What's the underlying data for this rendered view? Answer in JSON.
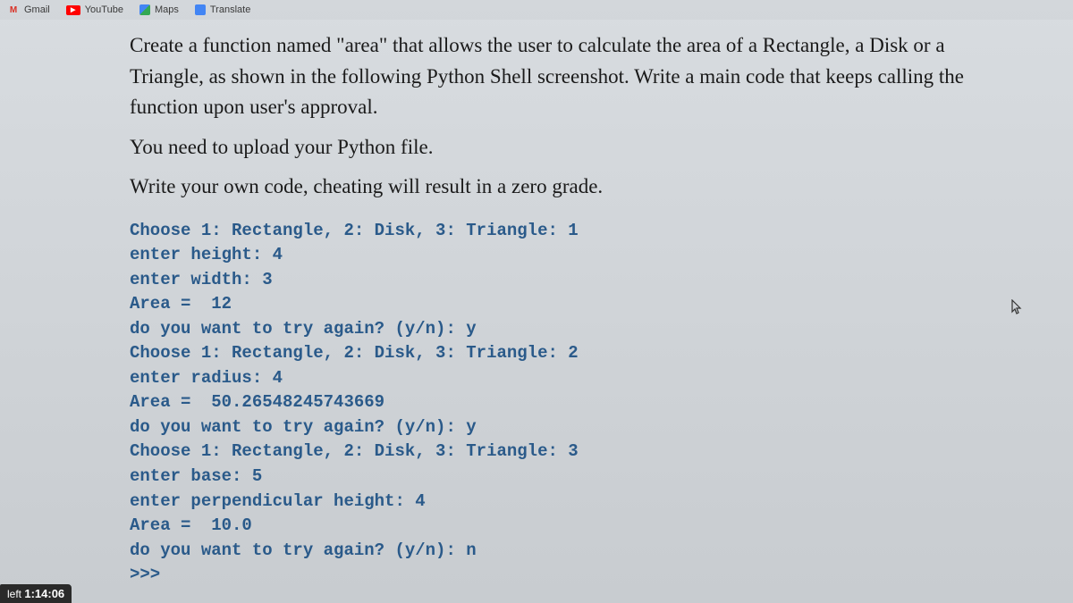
{
  "bookmarks": [
    {
      "label": "Gmail",
      "icon": "M"
    },
    {
      "label": "YouTube",
      "icon": "▶"
    },
    {
      "label": "Maps",
      "icon": ""
    },
    {
      "label": "Translate",
      "icon": ""
    }
  ],
  "instructions": {
    "p1": "Create a function named \"area\" that allows the user to calculate the area of a Rectangle, a Disk or a Triangle, as shown in the following Python Shell screenshot. Write a main code that keeps calling the function upon user's approval.",
    "p2": "You need to upload your Python file.",
    "p3": "Write your own code, cheating will result in a zero grade."
  },
  "shell": {
    "lines": [
      "Choose 1: Rectangle, 2: Disk, 3: Triangle: 1",
      "enter height: 4",
      "enter width: 3",
      "Area =  12",
      "do you want to try again? (y/n): y",
      "Choose 1: Rectangle, 2: Disk, 3: Triangle: 2",
      "enter radius: 4",
      "Area =  50.26548245743669",
      "do you want to try again? (y/n): y",
      "Choose 1: Rectangle, 2: Disk, 3: Triangle: 3",
      "enter base: 5",
      "enter perpendicular height: 4",
      "Area =  10.0",
      "do you want to try again? (y/n): n",
      ">>>"
    ]
  },
  "timer": {
    "prefix": "left ",
    "time": "1:14:06"
  }
}
